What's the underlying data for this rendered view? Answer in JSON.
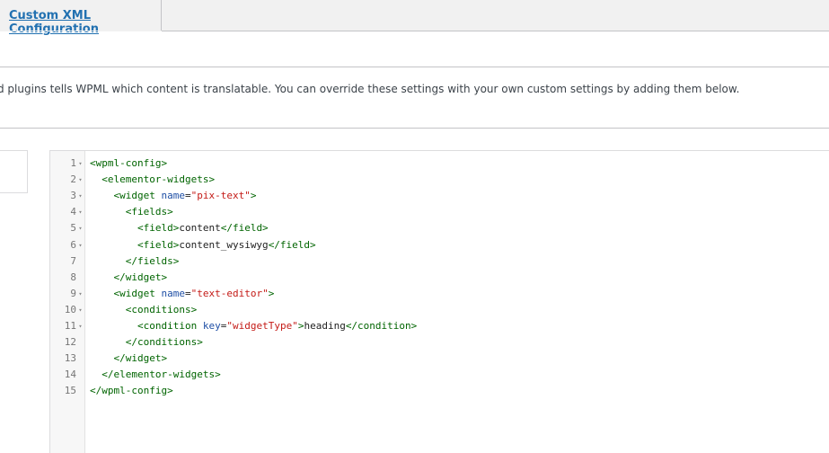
{
  "tabs": {
    "active_label": "Custom XML Configuration"
  },
  "description": "d plugins tells WPML which content is translatable. You can override these settings with your own custom settings by adding them below.",
  "colors": {
    "tag": "#006400",
    "attribute": "#1f4fa5",
    "value": "#c41a16",
    "link": "#2271b1"
  },
  "fold_icon": "triangle-down-icon",
  "editor": {
    "lines": [
      {
        "num": "1",
        "fold": "▾",
        "indent": 0,
        "tokens": [
          {
            "t": "tag",
            "v": "<wpml-config>"
          }
        ]
      },
      {
        "num": "2",
        "fold": "▾",
        "indent": 2,
        "tokens": [
          {
            "t": "tag",
            "v": "<elementor-widgets>"
          }
        ]
      },
      {
        "num": "3",
        "fold": "▾",
        "indent": 4,
        "tokens": [
          {
            "t": "tag",
            "v": "<widget "
          },
          {
            "t": "attr",
            "v": "name"
          },
          {
            "t": "txt",
            "v": "="
          },
          {
            "t": "val",
            "v": "\"pix-text\""
          },
          {
            "t": "tag",
            "v": ">"
          }
        ]
      },
      {
        "num": "4",
        "fold": "▾",
        "indent": 6,
        "tokens": [
          {
            "t": "tag",
            "v": "<fields>"
          }
        ]
      },
      {
        "num": "5",
        "fold": "▾",
        "indent": 8,
        "tokens": [
          {
            "t": "tag",
            "v": "<field>"
          },
          {
            "t": "txt",
            "v": "content"
          },
          {
            "t": "tag",
            "v": "</field>"
          }
        ]
      },
      {
        "num": "6",
        "fold": "▾",
        "indent": 8,
        "tokens": [
          {
            "t": "tag",
            "v": "<field>"
          },
          {
            "t": "txt",
            "v": "content_wysiwyg"
          },
          {
            "t": "tag",
            "v": "</field>"
          }
        ]
      },
      {
        "num": "7",
        "fold": "",
        "indent": 6,
        "tokens": [
          {
            "t": "tag",
            "v": "</fields>"
          }
        ]
      },
      {
        "num": "8",
        "fold": "",
        "indent": 4,
        "tokens": [
          {
            "t": "tag",
            "v": "</widget>"
          }
        ]
      },
      {
        "num": "9",
        "fold": "▾",
        "indent": 4,
        "tokens": [
          {
            "t": "tag",
            "v": "<widget "
          },
          {
            "t": "attr",
            "v": "name"
          },
          {
            "t": "txt",
            "v": "="
          },
          {
            "t": "val",
            "v": "\"text-editor\""
          },
          {
            "t": "tag",
            "v": ">"
          }
        ]
      },
      {
        "num": "10",
        "fold": "▾",
        "indent": 6,
        "tokens": [
          {
            "t": "tag",
            "v": "<conditions>"
          }
        ]
      },
      {
        "num": "11",
        "fold": "▾",
        "indent": 8,
        "tokens": [
          {
            "t": "tag",
            "v": "<condition "
          },
          {
            "t": "attr",
            "v": "key"
          },
          {
            "t": "txt",
            "v": "="
          },
          {
            "t": "val",
            "v": "\"widgetType\""
          },
          {
            "t": "tag",
            "v": ">"
          },
          {
            "t": "txt",
            "v": "heading"
          },
          {
            "t": "tag",
            "v": "</condition>"
          }
        ]
      },
      {
        "num": "12",
        "fold": "",
        "indent": 6,
        "tokens": [
          {
            "t": "tag",
            "v": "</conditions>"
          }
        ]
      },
      {
        "num": "13",
        "fold": "",
        "indent": 4,
        "tokens": [
          {
            "t": "tag",
            "v": "</widget>"
          }
        ]
      },
      {
        "num": "14",
        "fold": "",
        "indent": 2,
        "tokens": [
          {
            "t": "tag",
            "v": "</elementor-widgets>"
          }
        ]
      },
      {
        "num": "15",
        "fold": "",
        "indent": 0,
        "tokens": [
          {
            "t": "tag",
            "v": "</wpml-config>"
          }
        ]
      }
    ]
  }
}
